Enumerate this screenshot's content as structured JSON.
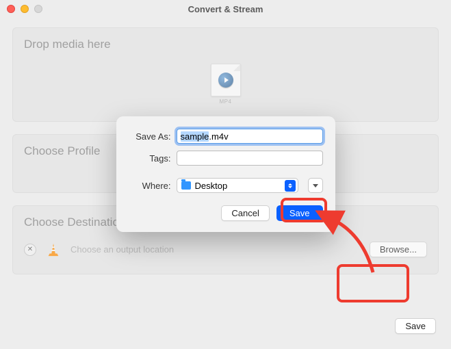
{
  "title": "Convert & Stream",
  "dropzone": {
    "heading": "Drop media here",
    "file_ext": "MP4"
  },
  "profile": {
    "heading": "Choose Profile"
  },
  "destination": {
    "heading": "Choose Destination",
    "placeholder": "Choose an output location",
    "browse_label": "Browse..."
  },
  "footer": {
    "save_label": "Save"
  },
  "sheet": {
    "saveas_label": "Save As:",
    "saveas_value_selected": "sample",
    "saveas_value_rest": ".m4v",
    "tags_label": "Tags:",
    "where_label": "Where:",
    "where_value": "Desktop",
    "cancel_label": "Cancel",
    "save_label": "Save"
  }
}
